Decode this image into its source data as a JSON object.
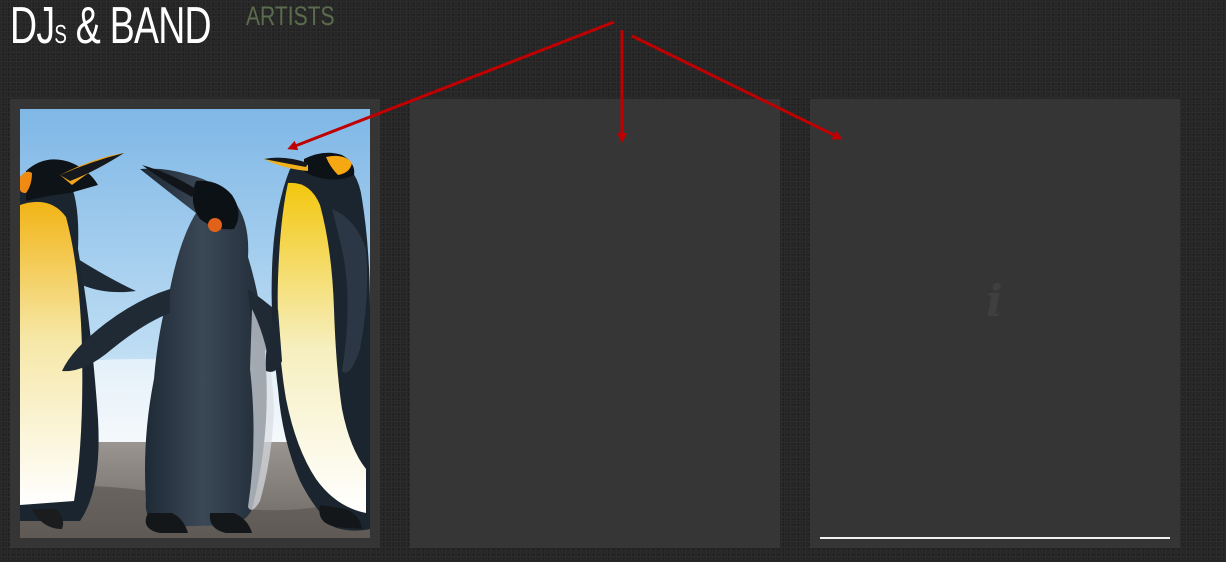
{
  "header": {
    "title_part_a": "DJ",
    "title_part_b": "S",
    "title_part_c": " & BAND",
    "subtitle": "ARTISTS"
  },
  "cards": [
    {
      "image": "penguins-photo"
    },
    {
      "state": "empty"
    },
    {
      "icon": "info-icon",
      "icon_glyph": "i"
    }
  ],
  "colors": {
    "background": "#262626",
    "card": "#353535",
    "title": "#ffffff",
    "subtitle": "#5a6c4d",
    "annotation_arrow": "#c00000",
    "underline": "#f2f2f2"
  }
}
